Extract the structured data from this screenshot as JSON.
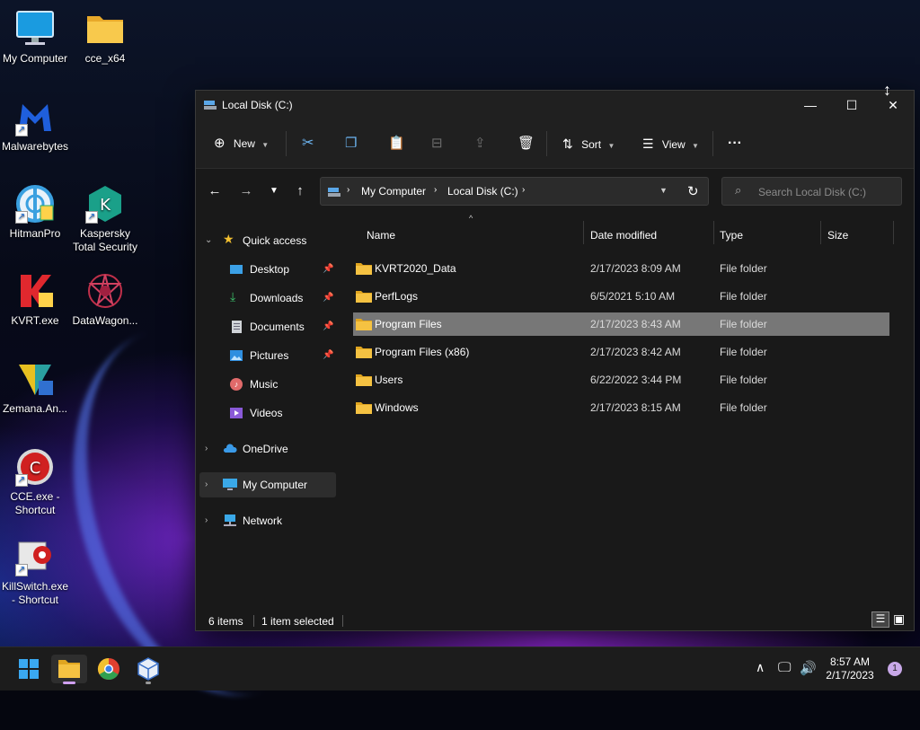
{
  "desktop": {
    "icons": [
      {
        "label": "My Computer"
      },
      {
        "label": "cce_x64"
      },
      {
        "label": "Malwarebytes"
      },
      {
        "label": "HitmanPro"
      },
      {
        "label": "Kaspersky Total Security"
      },
      {
        "label": "KVRT.exe"
      },
      {
        "label": "DataWagon..."
      },
      {
        "label": "Zemana.An..."
      },
      {
        "label": "CCE.exe - Shortcut"
      },
      {
        "label": "KillSwitch.exe - Shortcut"
      }
    ]
  },
  "window": {
    "title": "Local Disk (C:)",
    "controls": {
      "minimize": "—",
      "maximize": "☐",
      "close": "✕"
    },
    "toolbar": {
      "new_label": "New",
      "sort_label": "Sort",
      "view_label": "View",
      "more_label": "···"
    },
    "address": {
      "crumbs": [
        "My Computer",
        "Local Disk (C:)"
      ],
      "search_placeholder": "Search Local Disk (C:)"
    },
    "nav": {
      "quick_access": "Quick access",
      "items": [
        {
          "label": "Desktop",
          "pinned": true
        },
        {
          "label": "Downloads",
          "pinned": true
        },
        {
          "label": "Documents",
          "pinned": true
        },
        {
          "label": "Pictures",
          "pinned": true
        },
        {
          "label": "Music",
          "pinned": false
        },
        {
          "label": "Videos",
          "pinned": false
        }
      ],
      "onedrive": "OneDrive",
      "my_computer": "My Computer",
      "network": "Network"
    },
    "columns": {
      "name": "Name",
      "date": "Date modified",
      "type": "Type",
      "size": "Size"
    },
    "files": [
      {
        "name": "KVRT2020_Data",
        "date": "2/17/2023 8:09 AM",
        "type": "File folder"
      },
      {
        "name": "PerfLogs",
        "date": "6/5/2021 5:10 AM",
        "type": "File folder"
      },
      {
        "name": "Program Files",
        "date": "2/17/2023 8:43 AM",
        "type": "File folder",
        "selected": true
      },
      {
        "name": "Program Files (x86)",
        "date": "2/17/2023 8:42 AM",
        "type": "File folder"
      },
      {
        "name": "Users",
        "date": "6/22/2022 3:44 PM",
        "type": "File folder"
      },
      {
        "name": "Windows",
        "date": "2/17/2023 8:15 AM",
        "type": "File folder"
      }
    ],
    "status": {
      "items": "6 items",
      "selected": "1 item selected"
    }
  },
  "taskbar": {
    "time": "8:57 AM",
    "date": "2/17/2023",
    "notifications": "1"
  },
  "colors": {
    "accent": "#0078d4",
    "folder": "#f5c242",
    "selection": "#777777"
  }
}
